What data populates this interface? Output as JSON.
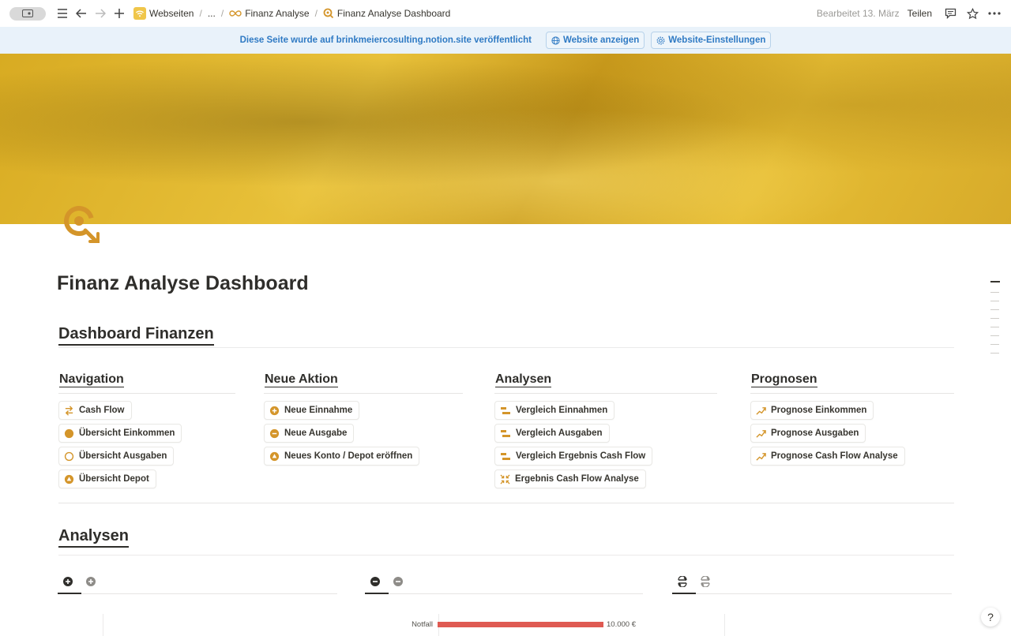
{
  "topbar": {
    "breadcrumbs": [
      "Webseiten",
      "...",
      "Finanz Analyse",
      "Finanz Analyse Dashboard"
    ],
    "edited": "Bearbeitet 13. März",
    "share": "Teilen"
  },
  "banner": {
    "text": "Diese Seite wurde auf brinkmeiercosulting.notion.site veröffentlicht",
    "view_site": "Website anzeigen",
    "site_settings": "Website-Einstellungen"
  },
  "page": {
    "title": "Finanz Analyse Dashboard",
    "section1": "Dashboard Finanzen",
    "section2": "Analysen"
  },
  "columns": [
    {
      "heading": "Navigation",
      "items": [
        "Cash Flow",
        "Übersicht Einkommen",
        "Übersicht Ausgaben",
        "Übersicht Depot"
      ]
    },
    {
      "heading": "Neue Aktion",
      "items": [
        "Neue Einnahme",
        "Neue Ausgabe",
        "Neues Konto / Depot eröffnen"
      ]
    },
    {
      "heading": "Analysen",
      "items": [
        "Vergleich Einnahmen",
        "Vergleich Ausgaben",
        "Vergleich Ergebnis Cash Flow",
        "Ergebnis Cash Flow Analyse"
      ]
    },
    {
      "heading": "Prognosen",
      "items": [
        "Prognose Einkommen",
        "Prognose Ausgaben",
        "Prognose Cash Flow Analyse"
      ]
    }
  ],
  "chart_preview": {
    "label": "Notfall",
    "value_label": "10.000 €"
  },
  "colors": {
    "accent": "#d4952a",
    "bar": "#df5a52",
    "banner_text": "#2f7ac4"
  },
  "help_label": "?"
}
